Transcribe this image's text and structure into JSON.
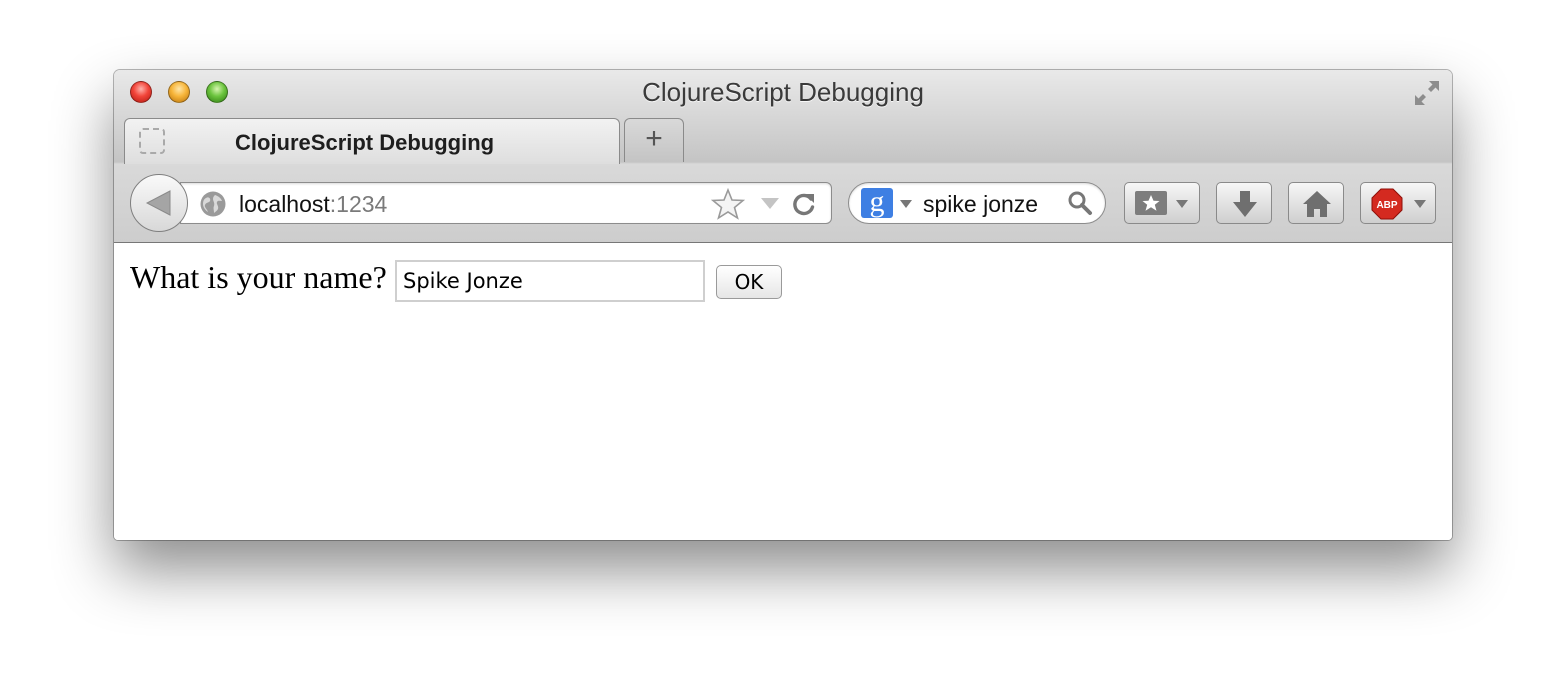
{
  "window": {
    "title": "ClojureScript Debugging"
  },
  "tabs": [
    {
      "label": "ClojureScript Debugging"
    }
  ],
  "new_tab_label": "+",
  "urlbar": {
    "host": "localhost",
    "port": ":1234"
  },
  "searchbar": {
    "engine_letter": "g",
    "query": "spike jonze"
  },
  "extension": {
    "badge": "ABP"
  },
  "page": {
    "prompt": "What is your name?",
    "name_value": "Spike Jonze",
    "ok_label": "OK"
  }
}
